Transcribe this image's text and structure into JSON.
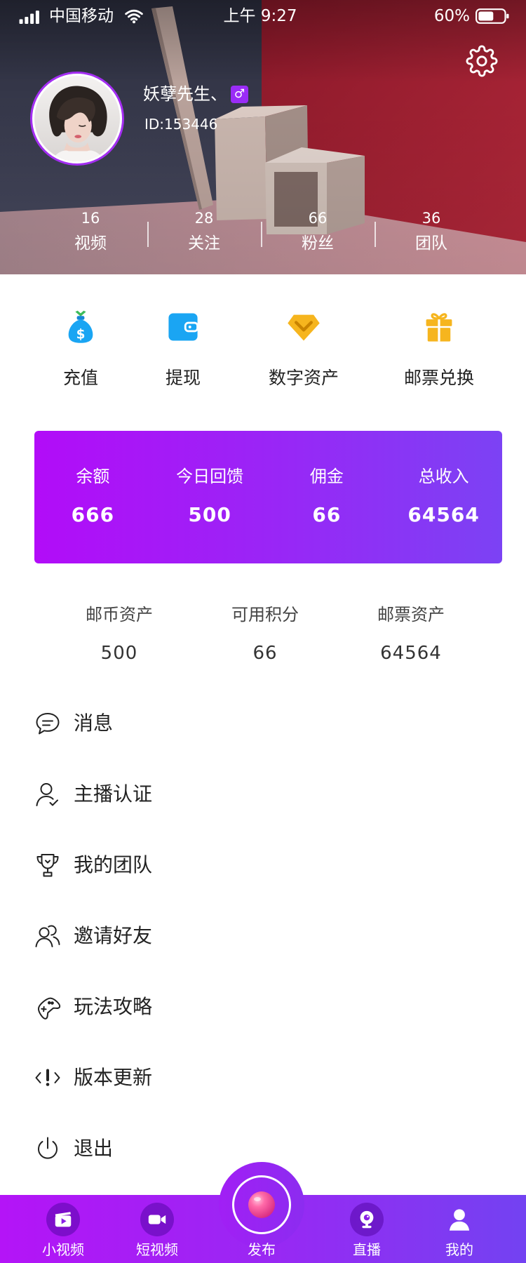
{
  "status_bar": {
    "carrier": "中国移动",
    "time": "上午 9:27",
    "battery": "60%",
    "icons": [
      "signal-icon",
      "wifi-icon",
      "battery-icon"
    ]
  },
  "header": {
    "settings_icon": "gear-icon"
  },
  "profile": {
    "name": "妖孽先生、",
    "gender_symbol": "♂",
    "user_id": "ID:153446",
    "stats": [
      {
        "value": "16",
        "label": "视频"
      },
      {
        "value": "28",
        "label": "关注"
      },
      {
        "value": "66",
        "label": "粉丝"
      },
      {
        "value": "36",
        "label": "团队"
      }
    ]
  },
  "quick_actions": [
    {
      "label": "充值",
      "icon": "money-bag-icon"
    },
    {
      "label": "提现",
      "icon": "wallet-icon"
    },
    {
      "label": "数字资产",
      "icon": "diamond-icon"
    },
    {
      "label": "邮票兑换",
      "icon": "gift-icon"
    }
  ],
  "balance_card": [
    {
      "label": "余额",
      "value": "666"
    },
    {
      "label": "今日回馈",
      "value": "500"
    },
    {
      "label": "佣金",
      "value": "66"
    },
    {
      "label": "总收入",
      "value": "64564"
    }
  ],
  "assets": [
    {
      "label": "邮币资产",
      "value": "500"
    },
    {
      "label": "可用积分",
      "value": "66"
    },
    {
      "label": "邮票资产",
      "value": "64564"
    }
  ],
  "menu": [
    {
      "label": "消息",
      "icon": "message-icon"
    },
    {
      "label": "主播认证",
      "icon": "user-verify-icon"
    },
    {
      "label": "我的团队",
      "icon": "trophy-icon"
    },
    {
      "label": "邀请好友",
      "icon": "users-icon"
    },
    {
      "label": "玩法攻略",
      "icon": "gamepad-icon"
    },
    {
      "label": "版本更新",
      "icon": "code-alert-icon"
    },
    {
      "label": "退出",
      "icon": "power-icon"
    }
  ],
  "tab_bar": [
    {
      "label": "小视频",
      "icon": "film-play-icon"
    },
    {
      "label": "短视频",
      "icon": "video-camera-icon"
    },
    {
      "label": "发布",
      "icon": "publish-orb-icon"
    },
    {
      "label": "直播",
      "icon": "webcam-icon"
    },
    {
      "label": "我的",
      "icon": "user-icon"
    }
  ],
  "colors": {
    "accent": "#a42ef2",
    "card_gradient_start": "#b20cf8",
    "card_gradient_end": "#7c42f4",
    "tab_gradient_start": "#b414f7",
    "tab_gradient_end": "#7342f2",
    "quick_action_blue": "#1aa5f3",
    "quick_action_yellow": "#f6b51e"
  }
}
